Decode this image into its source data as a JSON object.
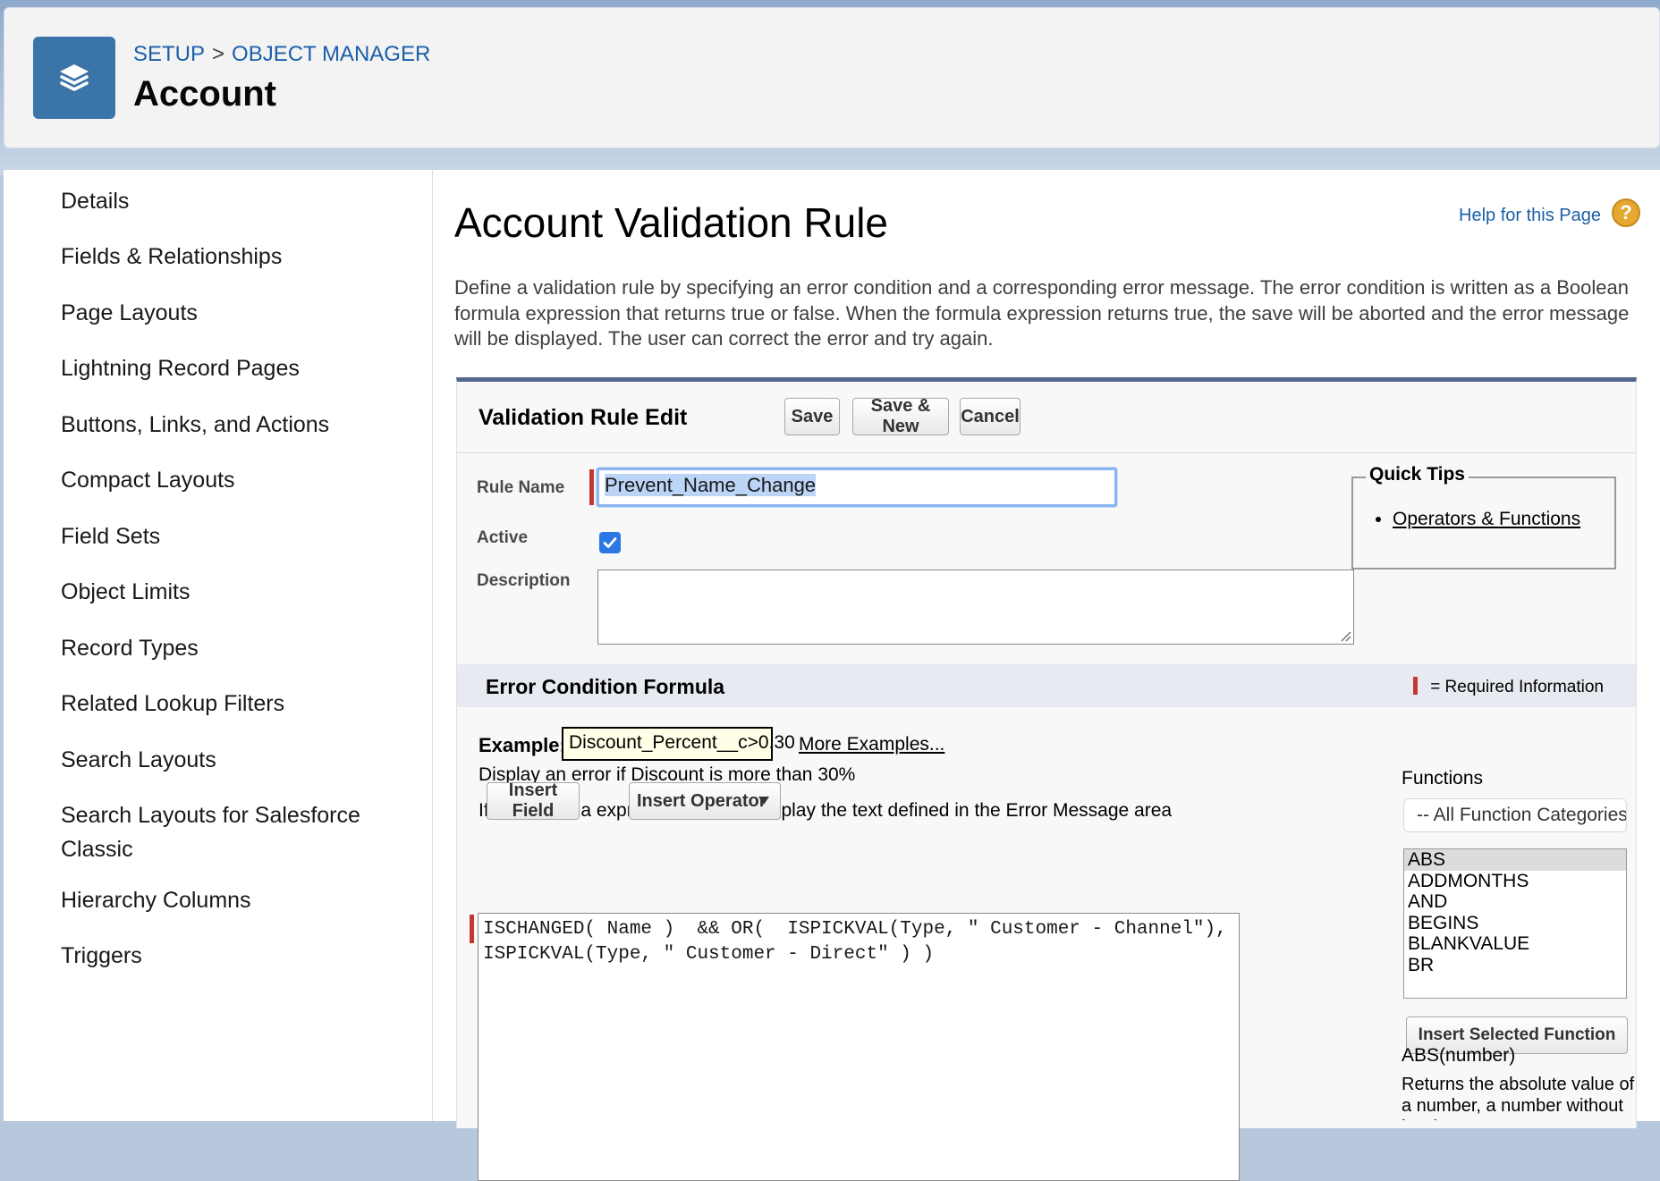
{
  "header": {
    "breadcrumb": [
      "SETUP",
      "OBJECT MANAGER"
    ],
    "breadcrumb_separator": ">",
    "title": "Account",
    "icon": "layers-icon"
  },
  "sidebar": {
    "items": [
      {
        "label": "Details"
      },
      {
        "label": "Fields & Relationships"
      },
      {
        "label": "Page Layouts"
      },
      {
        "label": "Lightning Record Pages"
      },
      {
        "label": "Buttons, Links, and Actions"
      },
      {
        "label": "Compact Layouts"
      },
      {
        "label": "Field Sets"
      },
      {
        "label": "Object Limits"
      },
      {
        "label": "Record Types"
      },
      {
        "label": "Related Lookup Filters"
      },
      {
        "label": "Search Layouts"
      },
      {
        "label": "Search Layouts for Salesforce Classic"
      },
      {
        "label": "Hierarchy Columns"
      },
      {
        "label": "Triggers"
      }
    ]
  },
  "main": {
    "title": "Account Validation Rule",
    "help_link": "Help for this Page",
    "help_icon": "?",
    "intro": "Define a validation rule by specifying an error condition and a corresponding error message. The error condition is written as a Boolean formula expression that returns true or false. When the formula expression returns true, the save will be aborted and the error message will be displayed. The user can correct the error and try again."
  },
  "edit_panel": {
    "title": "Validation Rule Edit",
    "save_label": "Save",
    "save_new_label": "Save & New",
    "cancel_label": "Cancel",
    "rule_name_label": "Rule Name",
    "rule_name_value": "Prevent_Name_Change",
    "active_label": "Active",
    "active_checked": true,
    "description_label": "Description",
    "description_value": ""
  },
  "quick_tips": {
    "title": "Quick Tips",
    "items": [
      "Operators & Functions"
    ]
  },
  "error_formula": {
    "section_title": "Error Condition Formula",
    "required_legend": "= Required Information",
    "example_label": "Example:",
    "example_value": "Discount_Percent__c>0.30",
    "more_examples": "More Examples...",
    "example_description": "Display an error if Discount is more than 30%",
    "hint_before": "If this formula expression is ",
    "hint_bold": "true",
    "hint_after": ", display the text defined in the Error Message area",
    "insert_field_label": "Insert Field",
    "insert_operator_label": "Insert Operator",
    "formula": "ISCHANGED( Name )  && OR(  ISPICKVAL(Type, \" Customer - Channel\"),\nISPICKVAL(Type, \" Customer - Direct\" ) )"
  },
  "functions": {
    "label": "Functions",
    "category_selected": "-- All Function Categories --",
    "list": [
      "ABS",
      "ADDMONTHS",
      "AND",
      "BEGINS",
      "BLANKVALUE",
      "BR"
    ],
    "selected": "ABS",
    "insert_label": "Insert Selected Function",
    "signature": "ABS(number)",
    "description": "Returns the absolute value of a number, a number without its sign"
  },
  "colors": {
    "accent": "#3b74a8",
    "link": "#1b5fa8",
    "required": "#c23934",
    "checkbox": "#2b78e4"
  }
}
